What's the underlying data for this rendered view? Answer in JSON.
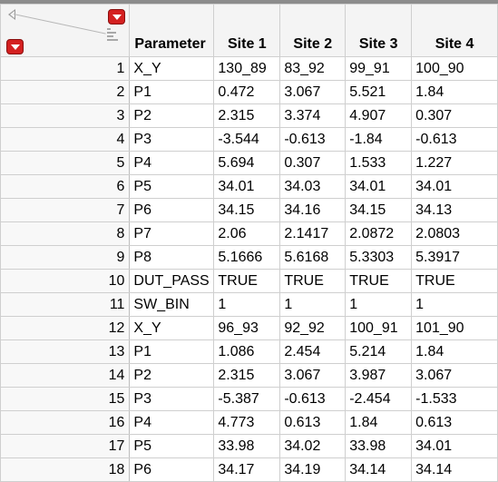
{
  "table": {
    "columns": [
      "Parameter",
      "Site 1",
      "Site 2",
      "Site 3",
      "Site 4"
    ],
    "rows": [
      {
        "num": "1",
        "cells": [
          "X_Y",
          "130_89",
          "83_92",
          "99_91",
          "100_90"
        ]
      },
      {
        "num": "2",
        "cells": [
          "P1",
          "0.472",
          "3.067",
          "5.521",
          "1.84"
        ]
      },
      {
        "num": "3",
        "cells": [
          "P2",
          "2.315",
          "3.374",
          "4.907",
          "0.307"
        ]
      },
      {
        "num": "4",
        "cells": [
          "P3",
          "-3.544",
          "-0.613",
          "-1.84",
          "-0.613"
        ]
      },
      {
        "num": "5",
        "cells": [
          "P4",
          "5.694",
          "0.307",
          "1.533",
          "1.227"
        ]
      },
      {
        "num": "6",
        "cells": [
          "P5",
          "34.01",
          "34.03",
          "34.01",
          "34.01"
        ]
      },
      {
        "num": "7",
        "cells": [
          "P6",
          "34.15",
          "34.16",
          "34.15",
          "34.13"
        ]
      },
      {
        "num": "8",
        "cells": [
          "P7",
          "2.06",
          "2.1417",
          "2.0872",
          "2.0803"
        ]
      },
      {
        "num": "9",
        "cells": [
          "P8",
          "5.1666",
          "5.6168",
          "5.3303",
          "5.3917"
        ]
      },
      {
        "num": "10",
        "cells": [
          "DUT_PASS",
          "TRUE",
          "TRUE",
          "TRUE",
          "TRUE"
        ]
      },
      {
        "num": "11",
        "cells": [
          "SW_BIN",
          "1",
          "1",
          "1",
          "1"
        ]
      },
      {
        "num": "12",
        "cells": [
          "X_Y",
          "96_93",
          "92_92",
          "100_91",
          "101_90"
        ]
      },
      {
        "num": "13",
        "cells": [
          "P1",
          "1.086",
          "2.454",
          "5.214",
          "1.84"
        ]
      },
      {
        "num": "14",
        "cells": [
          "P2",
          "2.315",
          "3.067",
          "3.987",
          "3.067"
        ]
      },
      {
        "num": "15",
        "cells": [
          "P3",
          "-5.387",
          "-0.613",
          "-2.454",
          "-1.533"
        ]
      },
      {
        "num": "16",
        "cells": [
          "P4",
          "4.773",
          "0.613",
          "1.84",
          "0.613"
        ]
      },
      {
        "num": "17",
        "cells": [
          "P5",
          "33.98",
          "34.02",
          "33.98",
          "34.01"
        ]
      },
      {
        "num": "18",
        "cells": [
          "P6",
          "34.17",
          "34.19",
          "34.14",
          "34.14"
        ]
      }
    ]
  },
  "icons": {
    "collapse": "triangle-left-icon",
    "table_menu": "red-dropdown-icon",
    "rows_menu": "red-dropdown-icon",
    "column_bars": "column-bars-icon"
  },
  "colors": {
    "menu_button": "#d42020",
    "header_bg": "#f4f4f4",
    "grid_line": "#cfcfcf"
  }
}
